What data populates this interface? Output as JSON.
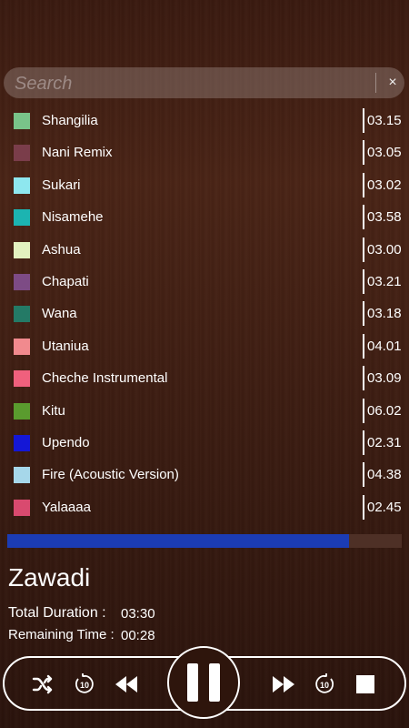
{
  "search": {
    "placeholder": "Search",
    "value": "",
    "clear_icon": "×"
  },
  "tracks": [
    {
      "title": "Shangilia",
      "duration": "03.15",
      "color": "#79c489"
    },
    {
      "title": "Nani Remix",
      "duration": "03.05",
      "color": "#7a3d4a"
    },
    {
      "title": "Sukari",
      "duration": "03.02",
      "color": "#8ee7ef"
    },
    {
      "title": "Nisamehe",
      "duration": "03.58",
      "color": "#1cb4b1"
    },
    {
      "title": "Ashua",
      "duration": "03.00",
      "color": "#e3f2c0"
    },
    {
      "title": "Chapati",
      "duration": "03.21",
      "color": "#7d4b85"
    },
    {
      "title": "Wana",
      "duration": "03.18",
      "color": "#247a66"
    },
    {
      "title": "Utaniua",
      "duration": "04.01",
      "color": "#f18a8e"
    },
    {
      "title": "Cheche Instrumental",
      "duration": "03.09",
      "color": "#f0607d"
    },
    {
      "title": "Kitu",
      "duration": "06.02",
      "color": "#5a9b2e"
    },
    {
      "title": "Upendo",
      "duration": "02.31",
      "color": "#1417d6"
    },
    {
      "title": "Fire (Acoustic Version)",
      "duration": "04.38",
      "color": "#a6d7ea"
    },
    {
      "title": "Yalaaaa",
      "duration": "02.45",
      "color": "#d94a6f"
    }
  ],
  "player": {
    "progress_fraction": 0.866,
    "now_playing": "Zawadi",
    "total_duration_label": "Total Duration :",
    "total_duration": "03:30",
    "remaining_time_label": "Remaining Time :",
    "remaining_time": "00:28",
    "progress_color": "#1b3cb4"
  },
  "controls": {
    "icons": [
      "shuffle-icon",
      "rewind-10-icon",
      "previous-icon",
      "pause-icon",
      "next-icon",
      "forward-10-icon",
      "stop-icon"
    ],
    "skip_seconds": "10"
  }
}
